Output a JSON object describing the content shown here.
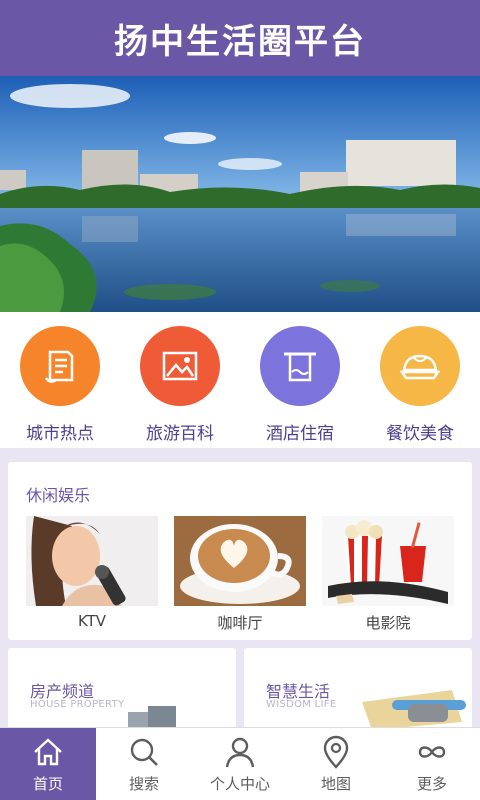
{
  "header": {
    "title": "扬中生活圈平台"
  },
  "banner": {
    "slides": 3,
    "active_slide": 1
  },
  "categories": [
    {
      "label": "城市热点",
      "icon": "document-icon",
      "color": "#f5842a"
    },
    {
      "label": "旅游百科",
      "icon": "picture-icon",
      "color": "#ef5b36"
    },
    {
      "label": "酒店住宿",
      "icon": "towel-rack-icon",
      "color": "#7c74dc"
    },
    {
      "label": "餐饮美食",
      "icon": "dumpling-icon",
      "color": "#f7b747"
    }
  ],
  "leisure": {
    "title": "休闲娱乐",
    "items": [
      {
        "label": "KTV",
        "image": "singer-photo"
      },
      {
        "label": "咖啡厅",
        "image": "latte-photo"
      },
      {
        "label": "电影院",
        "image": "popcorn-photo"
      }
    ]
  },
  "cards": [
    {
      "title": "房产频道",
      "subtitle": "HOUSE PROPERTY"
    },
    {
      "title": "智慧生活",
      "subtitle": "WISDOM LIFE"
    }
  ],
  "tabbar": [
    {
      "label": "首页",
      "icon": "home-icon",
      "active": true
    },
    {
      "label": "搜索",
      "icon": "search-icon",
      "active": false
    },
    {
      "label": "个人中心",
      "icon": "user-icon",
      "active": false
    },
    {
      "label": "地图",
      "icon": "map-pin-icon",
      "active": false
    },
    {
      "label": "更多",
      "icon": "infinity-icon",
      "active": false
    }
  ],
  "colors": {
    "brand": "#6a58a6",
    "page_bg": "#e9e5f2"
  }
}
